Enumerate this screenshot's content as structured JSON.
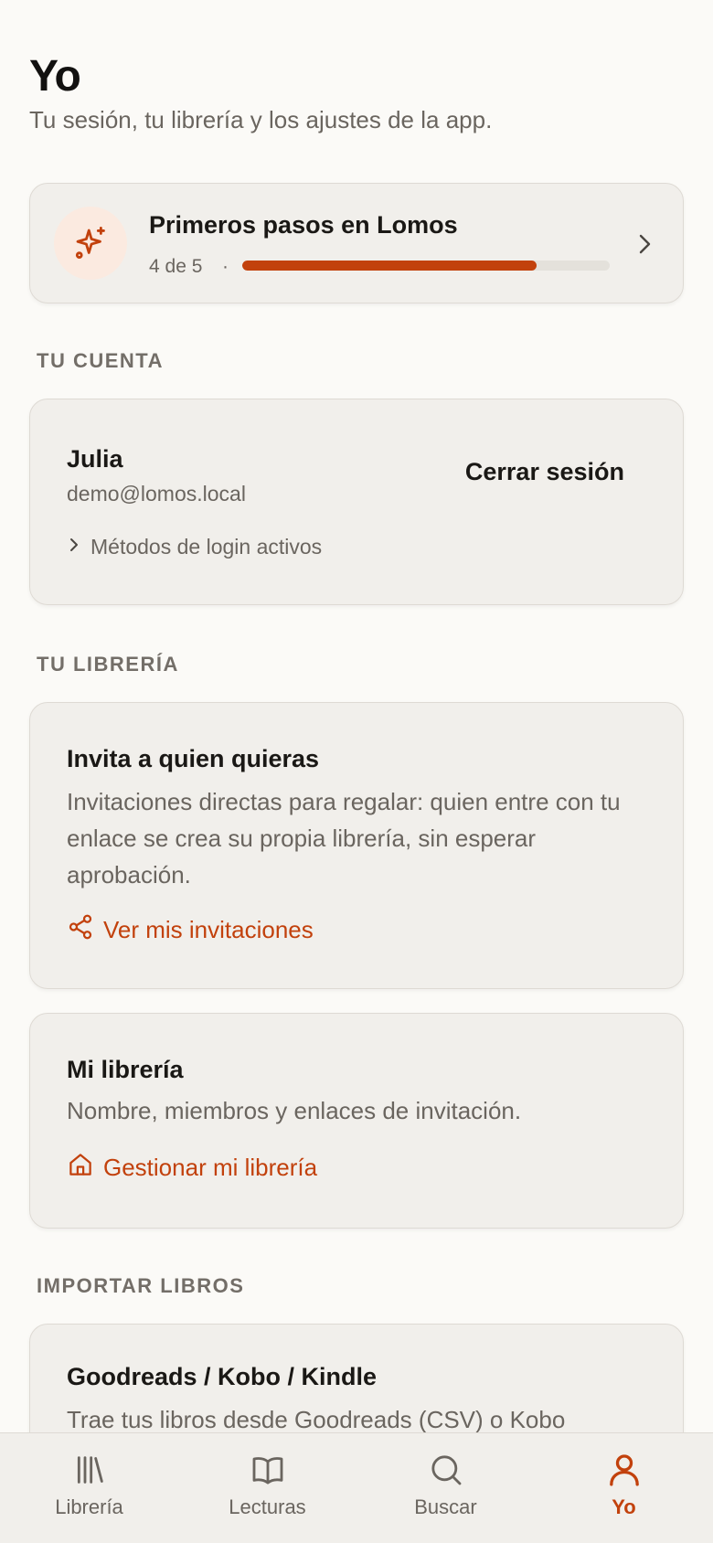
{
  "header": {
    "title": "Yo",
    "subtitle": "Tu sesión, tu librería y los ajustes de la app."
  },
  "onboarding": {
    "title": "Primeros pasos en Lomos",
    "count": "4 de 5",
    "separator": "·",
    "progress": 0.8,
    "icon": "sparkle-icon"
  },
  "sections": {
    "account": "TU CUENTA",
    "library": "TU LIBRERÍA",
    "import": "IMPORTAR LIBROS"
  },
  "account": {
    "name": "Julia",
    "email": "demo@lomos.local",
    "logout_label": "Cerrar sesión",
    "login_methods_label": "Métodos de login activos"
  },
  "invites": {
    "title": "Invita a quien quieras",
    "description": "Invitaciones directas para regalar: quien entre con tu enlace se crea su propia librería, sin esperar aprobación.",
    "link_label": "Ver mis invitaciones",
    "icon": "share-icon"
  },
  "my_library": {
    "title": "Mi librería",
    "description": "Nombre, miembros y enlaces de invitación.",
    "link_label": "Gestionar mi librería",
    "icon": "home-icon"
  },
  "import": {
    "title": "Goodreads / Kobo / Kindle",
    "description": "Trae tus libros desde Goodreads (CSV) o Kobo"
  },
  "tabs": [
    {
      "label": "Librería",
      "icon": "library-icon",
      "active": false
    },
    {
      "label": "Lecturas",
      "icon": "book-open-icon",
      "active": false
    },
    {
      "label": "Buscar",
      "icon": "search-icon",
      "active": false
    },
    {
      "label": "Yo",
      "icon": "user-icon",
      "active": true
    }
  ],
  "colors": {
    "accent": "#c2410c",
    "background": "#fbfaf7",
    "card": "#f1efeb"
  }
}
